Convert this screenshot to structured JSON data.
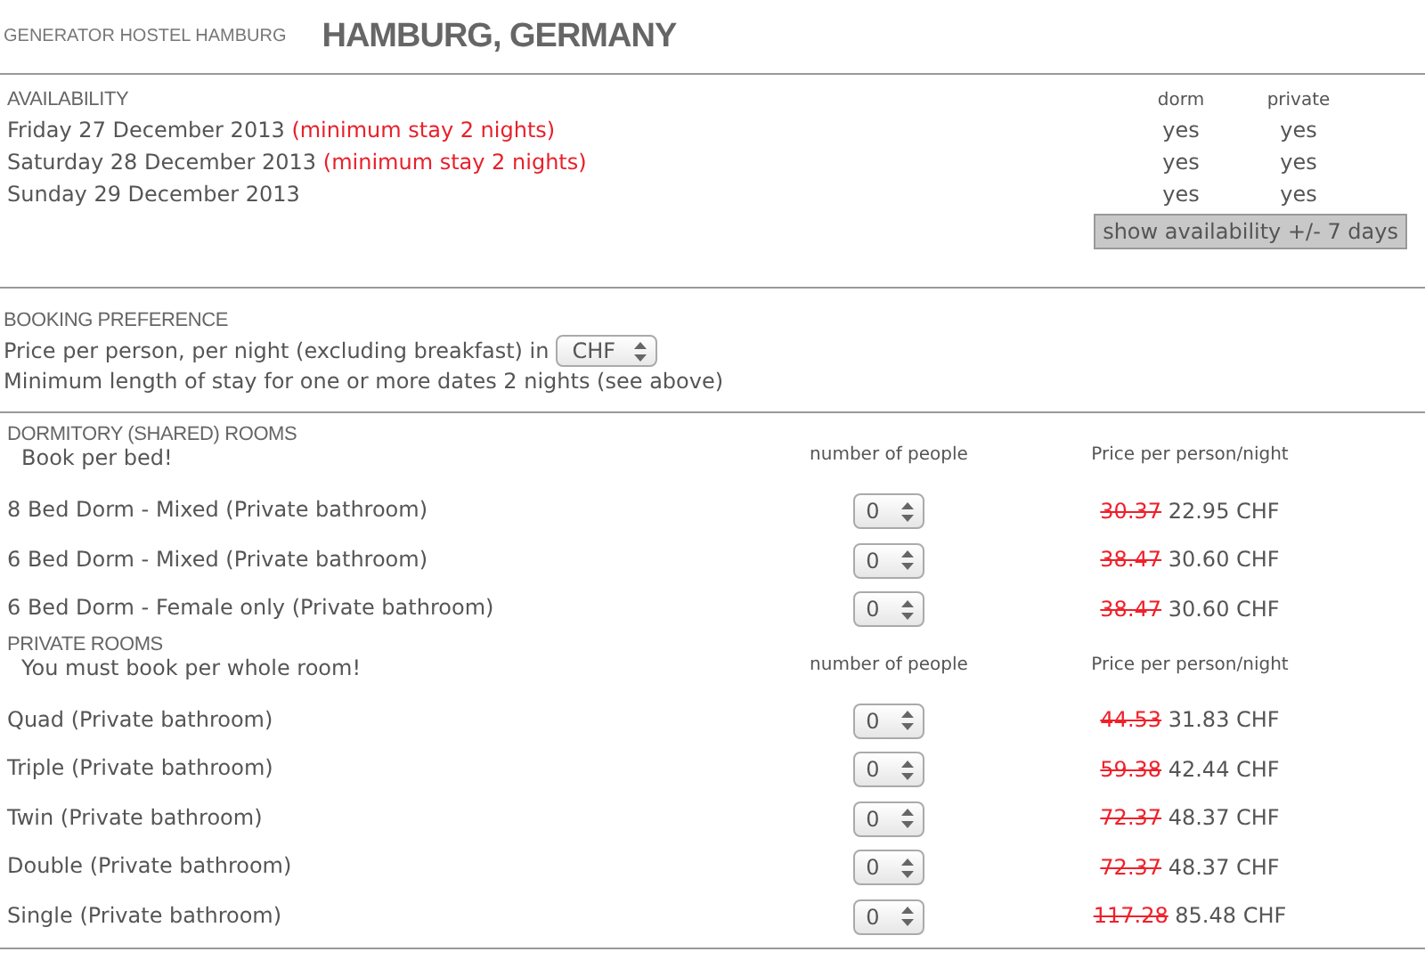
{
  "header": {
    "hostel": "GENERATOR HOSTEL HAMBURG",
    "city": "HAMBURG, GERMANY"
  },
  "availability": {
    "heading": "AVAILABILITY",
    "columns": [
      "dorm",
      "private"
    ],
    "rows": [
      {
        "date": "Friday 27 December 2013",
        "note": "(minimum stay 2 nights)",
        "dorm": "yes",
        "private": "yes"
      },
      {
        "date": "Saturday 28 December 2013",
        "note": "(minimum stay 2 nights)",
        "dorm": "yes",
        "private": "yes"
      },
      {
        "date": "Sunday 29 December 2013",
        "dorm": "yes",
        "private": "yes"
      }
    ],
    "button": "show availability +/- 7 days"
  },
  "booking_preference": {
    "heading": "BOOKING PREFERENCE",
    "currency_label": "Price per person, per night (excluding breakfast) in",
    "currency": "CHF",
    "minimum_stay": "Minimum length of stay for one or more dates 2 nights (see above)"
  },
  "room_sections": [
    {
      "heading": "DORMITORY (SHARED) ROOMS",
      "note": "Book per bed!",
      "columns": [
        "number of people",
        "Price per person/night"
      ],
      "rooms": [
        {
          "name": "8 Bed Dorm - Mixed (Private bathroom)",
          "people": "0",
          "old_price": "30.37",
          "price": "22.95 CHF"
        },
        {
          "name": "6 Bed Dorm - Mixed (Private bathroom)",
          "people": "0",
          "old_price": "38.47",
          "price": "30.60 CHF"
        },
        {
          "name": "6 Bed Dorm - Female only (Private bathroom)",
          "people": "0",
          "old_price": "38.47",
          "price": "30.60 CHF"
        }
      ]
    },
    {
      "heading": "PRIVATE ROOMS",
      "note": "You must book per whole room!",
      "columns": [
        "number of people",
        "Price per person/night"
      ],
      "rooms": [
        {
          "name": "Quad (Private bathroom)",
          "people": "0",
          "old_price": "44.53",
          "price": "31.83 CHF"
        },
        {
          "name": "Triple (Private bathroom)",
          "people": "0",
          "old_price": "59.38",
          "price": "42.44 CHF"
        },
        {
          "name": "Twin (Private bathroom)",
          "people": "0",
          "old_price": "72.37",
          "price": "48.37 CHF"
        },
        {
          "name": "Double (Private bathroom)",
          "people": "0",
          "old_price": "72.37",
          "price": "48.37 CHF"
        },
        {
          "name": "Single (Private bathroom)",
          "people": "0",
          "old_price": "117.28",
          "price": "85.48 CHF"
        }
      ]
    }
  ]
}
